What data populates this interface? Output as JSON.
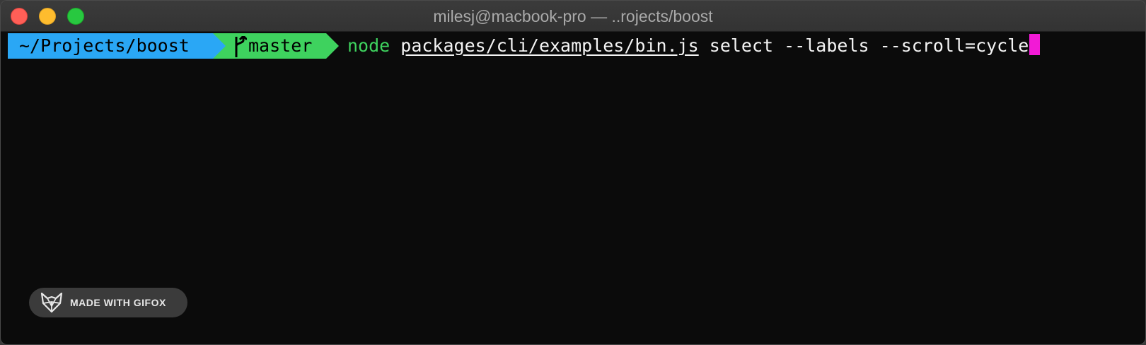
{
  "window": {
    "title": "milesj@macbook-pro — ..rojects/boost"
  },
  "prompt": {
    "path": "~/Projects/boost",
    "branch": "master",
    "branch_icon": "git-branch-icon"
  },
  "command": {
    "program": "node",
    "script": "packages/cli/examples/bin.js",
    "args": "select --labels --scroll=cycle"
  },
  "watermark": {
    "label": "MADE WITH GIFOX",
    "icon": "fox-icon"
  },
  "colors": {
    "path_segment": "#2aa7f5",
    "git_segment": "#3ed25e",
    "cursor": "#f21ad6",
    "background": "#0b0b0b"
  }
}
